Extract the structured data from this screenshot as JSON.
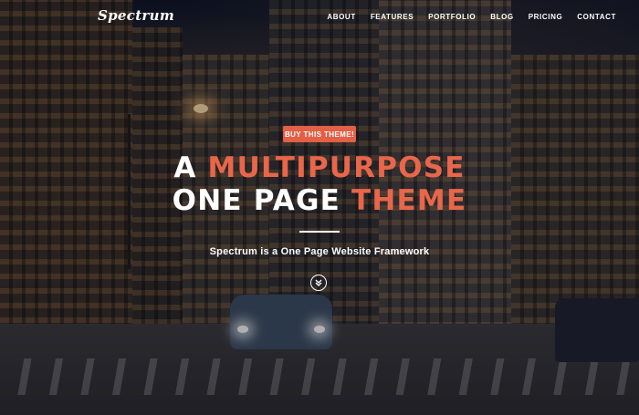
{
  "brand": {
    "logo": "Spectrum"
  },
  "nav": {
    "items": [
      "ABOUT",
      "FEATURES",
      "PORTFOLIO",
      "BLOG",
      "PRICING",
      "CONTACT"
    ]
  },
  "hero": {
    "cta_label": "BUY THIS THEME!",
    "headline_line1_prefix": "A ",
    "headline_line1_accent": "MULTIPURPOSE",
    "headline_line2_prefix": "ONE PAGE ",
    "headline_line2_accent": "THEME",
    "subtitle": "Spectrum is a One Page Website Framework"
  },
  "icons": {
    "scroll": "double-chevron-down-icon"
  },
  "colors": {
    "accent": "#e35f46",
    "text": "#ffffff"
  }
}
